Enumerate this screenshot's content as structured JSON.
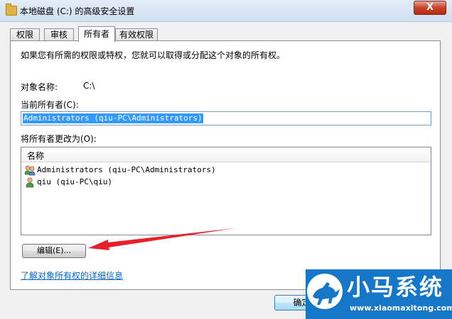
{
  "window": {
    "title": "本地磁盘 (C:) 的高级安全设置",
    "close_label": "X"
  },
  "tabs": [
    {
      "label": "权限",
      "active": false
    },
    {
      "label": "审核",
      "active": false
    },
    {
      "label": "所有者",
      "active": true
    },
    {
      "label": "有效权限",
      "active": false
    }
  ],
  "owner_page": {
    "description": "如果您有所需的权限或特权，您就可以取得或分配这个对象的所有权。",
    "object_name_label": "对象名称:",
    "object_name_value": "C:\\",
    "current_owner_label": "当前所有者(C):",
    "current_owner_value": "Administrators (qiu-PC\\Administrators)",
    "change_owner_label": "将所有者更改为(O):",
    "list_column_header": "名称",
    "owners": [
      {
        "name": "Administrators (qiu-PC\\Administrators)",
        "icon": "group-users-icon"
      },
      {
        "name": "qiu (qiu-PC\\qiu)",
        "icon": "user-icon"
      }
    ],
    "edit_button_label": "编辑(E)...",
    "details_link": "了解对象所有权的详细信息"
  },
  "footer": {
    "ok_button_label": "确定"
  },
  "watermark": {
    "brand": "小马系统",
    "url": "www.xiaomaxitong.com"
  },
  "colors": {
    "selection": "#3399ff",
    "link": "#0066cc",
    "arrow": "#e8202a",
    "watermark_bg": "#1677c9"
  }
}
